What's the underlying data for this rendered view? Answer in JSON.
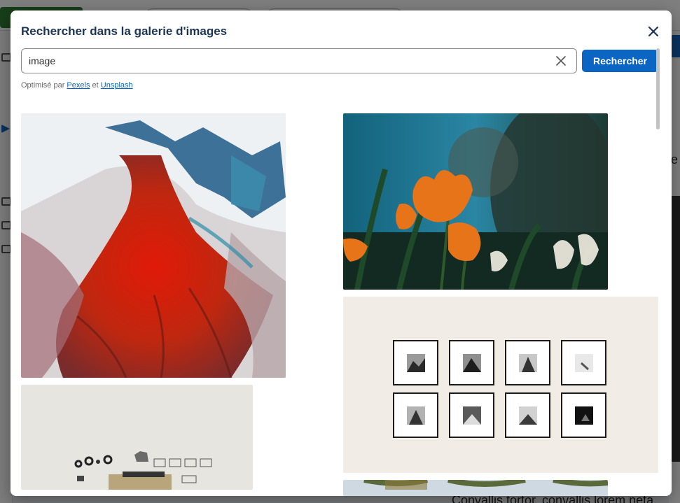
{
  "background": {
    "bottom_text": "Convallis tortor, convallis lorem neta",
    "right_fragment": "e"
  },
  "modal": {
    "title": "Rechercher dans la galerie d'images",
    "close_icon": "close-icon"
  },
  "search": {
    "value": "image",
    "clear_icon": "clear-icon",
    "button_label": "Rechercher"
  },
  "attribution": {
    "prefix": "Optimisé par",
    "pexels": "Pexels",
    "conjunction": "et",
    "unsplash": "Unsplash"
  },
  "results": [
    {
      "subject": "red-aerial-glacier"
    },
    {
      "subject": "orange-tulips"
    },
    {
      "subject": "framed-wall-gallery"
    },
    {
      "subject": "vintage-camera-flatlay"
    },
    {
      "subject": "trees-sky"
    }
  ],
  "colors": {
    "primary": "#0a66c2",
    "title": "#1c3554"
  }
}
